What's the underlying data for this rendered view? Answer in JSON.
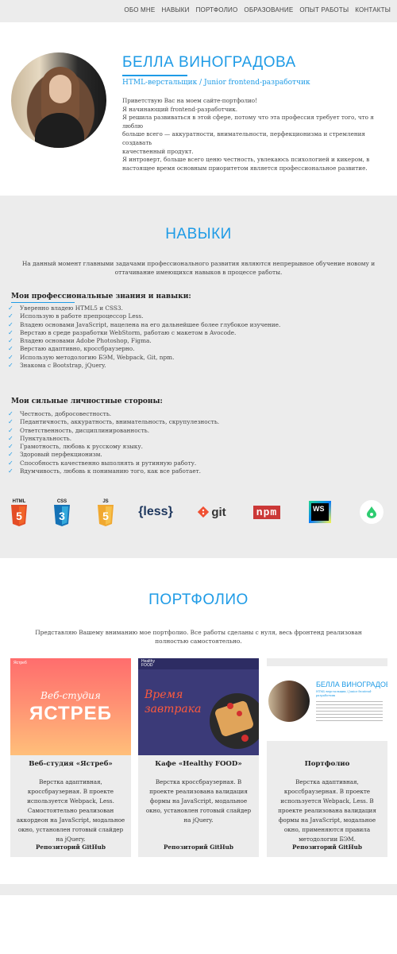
{
  "nav": {
    "items": [
      "ОБО МНЕ",
      "НАВЫКИ",
      "ПОРТФОЛИО",
      "ОБРАЗОВАНИЕ",
      "ОПЫТ РАБОТЫ",
      "КОНТАКТЫ"
    ]
  },
  "hero": {
    "name": "БЕЛЛА ВИНОГРАДОВА",
    "subtitle": "HTML-верстальщик / Junior frontend-разработчик",
    "bio": [
      "Приветствую Вас на моем сайте-портфолио!",
      "Я начинающий frontend-разработчик.",
      "Я решила развиваться в этой сфере, потому что эта профессия требует того, что я люблю",
      "больше всего — аккуратности, внимательности, перфекционизма и стремления создавать",
      "качественный продукт.",
      "Я интроверт, больше всего ценю честность, увлекаюсь психологией и кикером, в",
      "настоящее время основным приоритетом является профессиональное развитие."
    ]
  },
  "skills": {
    "title": "НАВЫКИ",
    "intro": "На данный момент главными задачами профессионального развития являются непрерывное обучение новому и оттачивание имеющихся навыков в процессе работы.",
    "professional_heading": "Мои профессиональные знания и навыки:",
    "professional": [
      "Уверенно владею HTML5 и CSS3.",
      "Использую в работе препроцессор Less.",
      "Владею основами JavaScript, нацелена на его дальнейшее более глубокое изучение.",
      "Верстаю в среде разработки WebStorm, работаю с макетом в Avocode.",
      "Владею основами Adobe Photoshop, Figma.",
      "Верстаю адаптивно, кроссбраузерно.",
      "Использую методологию БЭМ, Webpack, Git, npm.",
      "Знакома с Bootstrap, jQuery."
    ],
    "personal_heading": "Мои сильные личностные стороны:",
    "personal": [
      "Честность, добросовестность.",
      "Педантичность, аккуратность, внимательность, скрупулезность.",
      "Ответственность, дисциплинированность.",
      "Пунктуальность.",
      "Грамотность, любовь к русскому языку.",
      "Здоровый перфекционизм.",
      "Способность качественно выполнять и рутинную работу.",
      "Вдумчивость, любовь к пониманию того, как все работает."
    ],
    "tech_icons": [
      {
        "label": "HTML",
        "num": "5",
        "icon": "html5-icon",
        "color": "#e44d26"
      },
      {
        "label": "CSS",
        "num": "3",
        "icon": "css3-icon",
        "color": "#1572b6"
      },
      {
        "label": "JS",
        "num": "5",
        "icon": "js-icon",
        "color": "#f0a830"
      },
      {
        "label": "{less}",
        "icon": "less-icon",
        "color": "#1d365d"
      },
      {
        "label": "git",
        "icon": "git-icon",
        "color": "#f05033"
      },
      {
        "label": "npm",
        "icon": "npm-icon",
        "color": "#cb3837"
      },
      {
        "label": "WS",
        "icon": "webstorm-icon",
        "color": "#000000"
      },
      {
        "label": "",
        "icon": "avocode-icon",
        "color": "#2ecc71"
      }
    ]
  },
  "portfolio": {
    "title": "ПОРТФОЛИО",
    "intro": "Представляю Вашему вниманию мое портфолио. Все работы сделаны с нуля, весь фронтенд реализован полностью самостоятельно.",
    "cards": [
      {
        "title": "Веб-студия «Ястреб»",
        "desc": "Верстка адаптивная, кроссбраузерная. В проекте используется Webpack, Less. Самостоятельно реализован аккордеон на JavaScript, модальное окно, установлен готовый слайдер на jQuery.",
        "link": "Репозиторий GitHub",
        "img_logo": "Ястреб",
        "img_sub": "Веб-студия",
        "img_main": "ЯСТРЕБ"
      },
      {
        "title": "Кафе «Healthy FOOD»",
        "desc": "Верстка кроссбраузерная. В проекте реализована валидация формы на JavaScript, модальное окно, установлен готовый слайдер на jQuery.",
        "link": "Репозиторий GitHub",
        "img_logo": "Healthy FOOD",
        "img_main1": "Время",
        "img_main2": "завтрака"
      },
      {
        "title": "Портфолио",
        "desc": "Верстка адаптивная, кроссбраузерная. В проекте используется Webpack, Less. В проекте реализована валидация формы на JavaScript, модальное окно, применяются правила методологии БЭМ.",
        "link": "Репозиторий GitHub",
        "img_name": "БЕЛЛА ВИНОГРАДОВА",
        "img_sub": "HTML-верстальщик / Junior frontend-разработчик"
      }
    ]
  },
  "colors": {
    "accent": "#1e9be6",
    "section_bg": "#ececec"
  }
}
